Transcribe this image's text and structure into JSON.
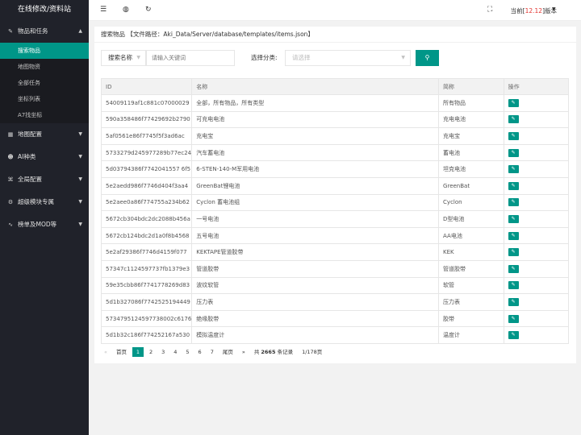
{
  "sidebar": {
    "title": "在线修改/资料站",
    "groups": [
      {
        "label": "物品和任务",
        "icon": "edit-icon"
      },
      {
        "label": "地图配置",
        "icon": "map-icon"
      },
      {
        "label": "AI种类",
        "icon": "users-icon"
      },
      {
        "label": "全局配置",
        "icon": "settings-icon"
      },
      {
        "label": "超级模块专属",
        "icon": "gear-icon"
      },
      {
        "label": "榜单及MOD等",
        "icon": "chart-icon"
      }
    ],
    "sub_items": [
      {
        "label": "搜索物品",
        "active": true
      },
      {
        "label": "地图物资"
      },
      {
        "label": "全部任务"
      },
      {
        "label": "坐标列表"
      },
      {
        "label": "A7找坐标"
      }
    ]
  },
  "header": {
    "version_prefix": "当前[",
    "version_number": "12.12",
    "version_suffix": "]版本"
  },
  "card": {
    "title": "搜索物品 【文件路径：Aki_Data/Server/database/templates/items.json】"
  },
  "search": {
    "field_select": "搜索名称",
    "keyword_placeholder": "请输入关键词",
    "category_label": "选择分类:",
    "category_placeholder": "请选择"
  },
  "table": {
    "headers": {
      "id": "ID",
      "name": "名称",
      "short": "简称",
      "op": "操作"
    },
    "rows": [
      {
        "id": "54009119af1c881c07000029",
        "name": "全部，所有物品，所有类型",
        "short": "所有物品"
      },
      {
        "id": "590a358486f77429692b2790",
        "name": "可充电电池",
        "short": "充电电池"
      },
      {
        "id": "5af0561e86f7745f5f3ad6ac",
        "name": "充电宝",
        "short": "充电宝"
      },
      {
        "id": "5733279d245977289b77ec24",
        "name": "汽车蓄电池",
        "short": "蓄电池"
      },
      {
        "id": "5d03794386f7742041557 6f5",
        "name": "6-STEN-140-M军用电池",
        "short": "坦克电池"
      },
      {
        "id": "5e2aedd986f7746d404f3aa4",
        "name": "GreenBat锂电池",
        "short": "GreenBat"
      },
      {
        "id": "5e2aee0a86f774755a234b62",
        "name": "Cyclon 蓄电池组",
        "short": "Cyclon"
      },
      {
        "id": "5672cb304bdc2dc2088b456a",
        "name": "一号电池",
        "short": "D型电池"
      },
      {
        "id": "5672cb124bdc2d1a0f8b4568",
        "name": "五号电池",
        "short": "AA电池"
      },
      {
        "id": "5e2af29386f7746d4159f077",
        "name": "KEKTAPE管道胶带",
        "short": "KEK"
      },
      {
        "id": "57347c1124597737fb1379e3",
        "name": "管道胶带",
        "short": "管道胶带"
      },
      {
        "id": "59e35cbb86f7741778269d83",
        "name": "波纹软管",
        "short": "软管"
      },
      {
        "id": "5d1b327086f7742525194449",
        "name": "压力表",
        "short": "压力表"
      },
      {
        "id": "5734795124597738002c6176",
        "name": "绝缘胶带",
        "short": "胶带"
      },
      {
        "id": "5d1b32c186f774252167a530",
        "name": "模拟温度计",
        "short": "温度计"
      }
    ]
  },
  "pager": {
    "first": "首页",
    "pages": [
      "1",
      "2",
      "3",
      "4",
      "5",
      "6",
      "7"
    ],
    "last": "尾页",
    "total_prefix": "共",
    "total_count": "2665",
    "total_suffix": "条记录",
    "page_info": "1/178页"
  }
}
